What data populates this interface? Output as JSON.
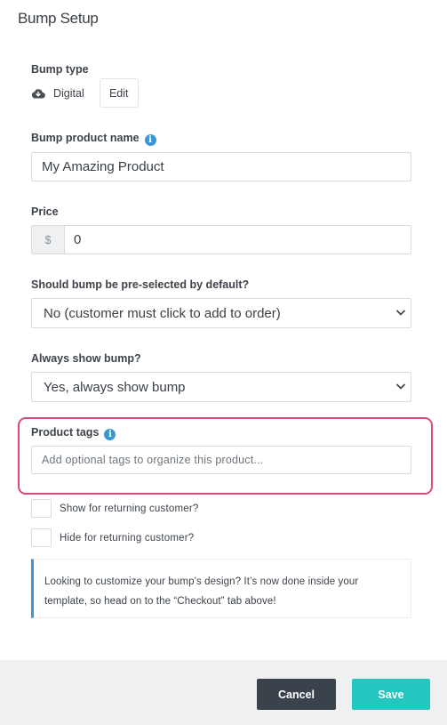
{
  "page": {
    "title": "Bump Setup"
  },
  "bump_type": {
    "label": "Bump type",
    "icon": "cloud-download-icon",
    "value": "Digital",
    "edit_label": "Edit"
  },
  "product_name": {
    "label": "Bump product name",
    "info_icon": "info-icon",
    "value": "My Amazing Product"
  },
  "price": {
    "label": "Price",
    "currency_symbol": "$",
    "value": "0"
  },
  "preselected": {
    "label": "Should bump be pre-selected by default?",
    "selected": "No (customer must click to add to order)"
  },
  "always_show": {
    "label": "Always show bump?",
    "selected": "Yes, always show bump"
  },
  "product_tags": {
    "label": "Product tags",
    "info_icon": "info-icon",
    "placeholder": "Add optional tags to organize this product...",
    "highlight_color": "#db4b78"
  },
  "checkboxes": [
    {
      "label": "Show for returning customer?",
      "checked": false
    },
    {
      "label": "Hide for returning customer?",
      "checked": false
    }
  ],
  "notice": {
    "text": "Looking to customize your bump’s design? It’s now done inside your template, so head on to the “Checkout” tab above!",
    "accent_color": "#3a97d6"
  },
  "footer": {
    "cancel_label": "Cancel",
    "save_label": "Save",
    "save_color": "#26c6c0",
    "cancel_color": "#3a434c"
  }
}
